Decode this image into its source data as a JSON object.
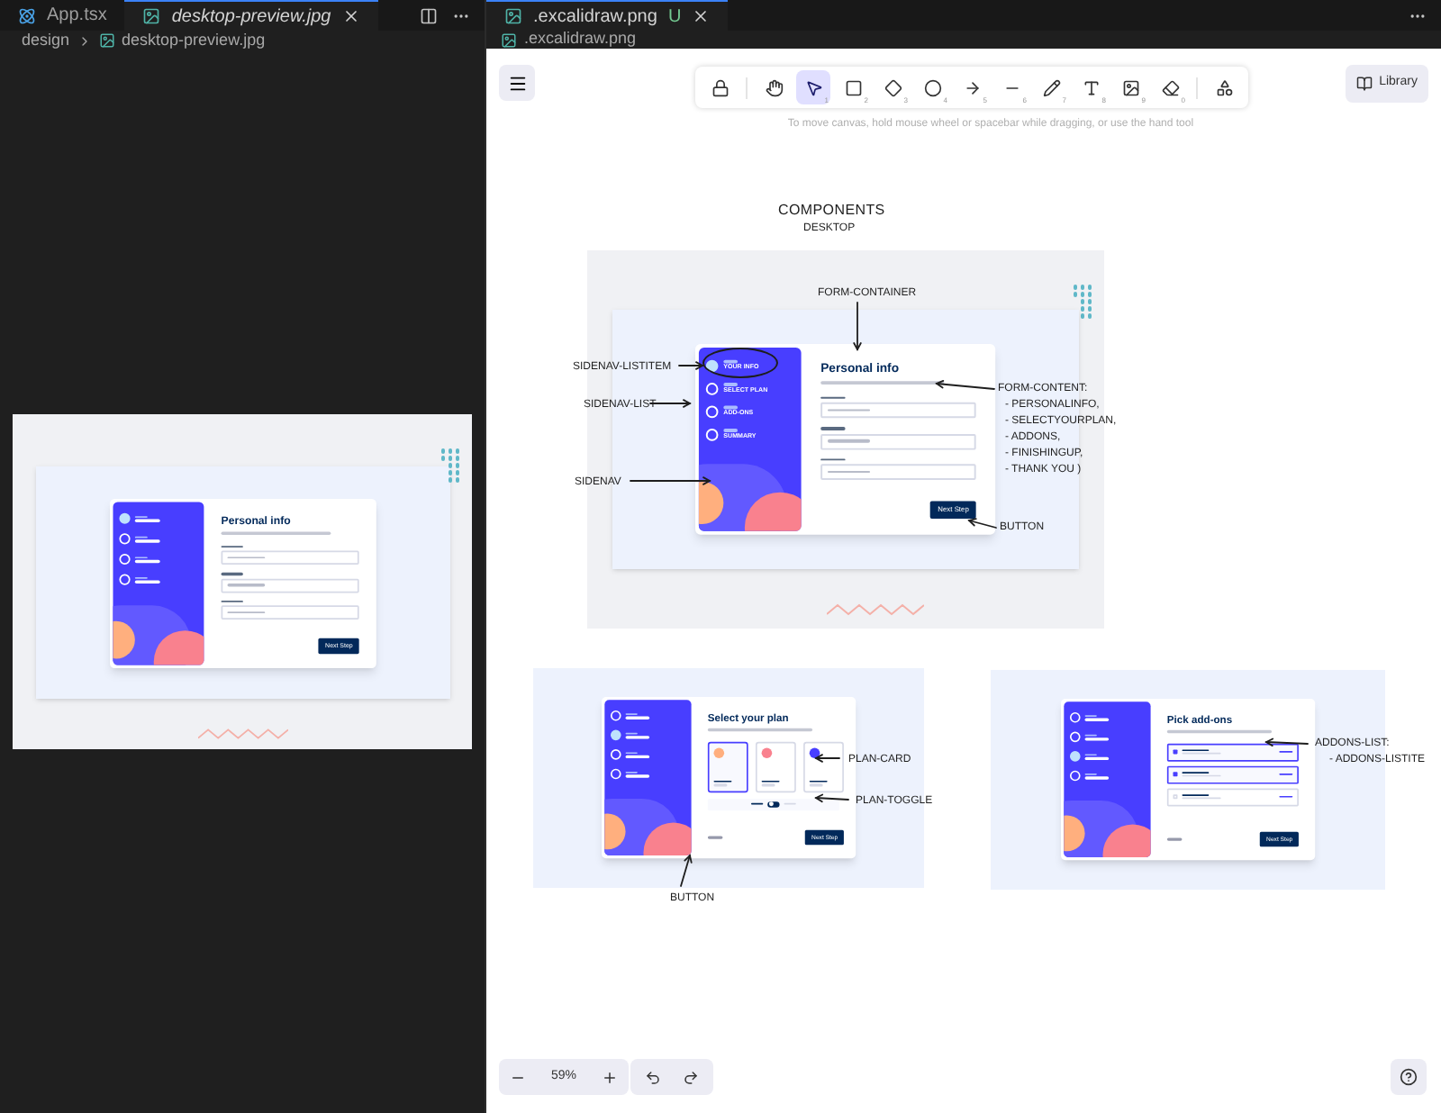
{
  "left_pane": {
    "tabs": [
      {
        "label": "App.tsx",
        "kind": "react",
        "selected": false
      },
      {
        "label": "desktop-preview.jpg",
        "kind": "image",
        "selected": true
      }
    ],
    "breadcrumb": [
      "design",
      "desktop-preview.jpg"
    ],
    "preview": {
      "kind": "personal",
      "title": "Personal info",
      "button": "Next Step",
      "steps": [
        {
          "selected": true
        },
        {
          "selected": false
        },
        {
          "selected": false
        },
        {
          "selected": false
        }
      ]
    }
  },
  "right_pane": {
    "tabs": [
      {
        "label": ".excalidraw.png",
        "badge": "U",
        "selected": true
      }
    ],
    "breadcrumb": ".excalidraw.png",
    "toolbar": [
      {
        "kind": "lock",
        "selected": false
      },
      {
        "kind": "hand",
        "selected": false
      },
      {
        "kind": "select",
        "shortcut": "1",
        "selected": true
      },
      {
        "kind": "rectangle",
        "shortcut": "2",
        "selected": false
      },
      {
        "kind": "diamond",
        "shortcut": "3",
        "selected": false
      },
      {
        "kind": "ellipse",
        "shortcut": "4",
        "selected": false
      },
      {
        "kind": "arrow",
        "shortcut": "5",
        "selected": false
      },
      {
        "kind": "line",
        "shortcut": "6",
        "selected": false
      },
      {
        "kind": "pencil",
        "shortcut": "7",
        "selected": false
      },
      {
        "kind": "text",
        "shortcut": "8",
        "selected": false
      },
      {
        "kind": "image",
        "shortcut": "9",
        "selected": false
      },
      {
        "kind": "eraser",
        "shortcut": "0",
        "selected": false
      },
      {
        "kind": "more",
        "selected": false
      }
    ],
    "library": "Library",
    "hint": "To move canvas, hold mouse wheel or spacebar while dragging, or use the hand tool",
    "canvas": {
      "heading": "COMPONENTS",
      "subheading": "DESKTOP",
      "mockups": [
        {
          "kind": "personal",
          "title": "Personal info",
          "button": "Next Step",
          "steps": [
            {
              "label": "YOUR INFO",
              "selected": true
            },
            {
              "label": "SELECT PLAN",
              "selected": false
            },
            {
              "label": "ADD-ONS",
              "selected": false
            },
            {
              "label": "SUMMARY",
              "selected": false
            }
          ]
        },
        {
          "kind": "plan",
          "title": "Select your plan",
          "button": "Next Step",
          "steps": [
            {
              "selected": false
            },
            {
              "selected": true
            },
            {
              "selected": false
            },
            {
              "selected": false
            }
          ]
        },
        {
          "kind": "addons",
          "title": "Pick add-ons",
          "button": "Next Step",
          "steps": [
            {
              "selected": false
            },
            {
              "selected": false
            },
            {
              "selected": true
            },
            {
              "selected": false
            }
          ]
        }
      ],
      "annotations": [
        "FORM-CONTAINER",
        "SIDENAV-LISTITEM",
        "SIDENAV-LIST",
        "SIDENAV",
        "FORM-CONTENT:",
        "- PERSONALINFO,",
        "- SELECTYOURPLAN,",
        "- ADDONS,",
        "- FINISHINGUP,",
        "- THANK YOU )",
        "BUTTON",
        "PLAN-CARD",
        "PLAN-TOGGLE",
        "BUTTON",
        "ADDONS-LIST:",
        "- ADDONS-LISTITE"
      ]
    },
    "zoom": "59%"
  }
}
